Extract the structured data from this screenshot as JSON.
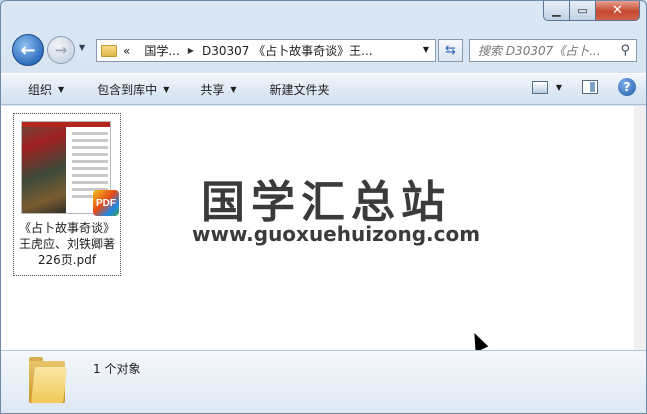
{
  "window": {
    "minimize_icon": "minimize-icon",
    "maximize_icon": "maximize-icon",
    "close_icon": "close-icon"
  },
  "nav": {
    "back_icon": "back-arrow-icon",
    "forward_icon": "forward-arrow-icon",
    "history_icon": "chevron-down-icon",
    "breadcrumb": {
      "overflow": "«",
      "items": [
        "国学...",
        "D30307 《占卜故事奇谈》王..."
      ]
    },
    "refresh_icon": "refresh-icon",
    "search_placeholder": "搜索 D30307《占卜...",
    "search_icon": "search-icon"
  },
  "commands": {
    "organize": "组织",
    "include_library": "包含到库中",
    "share": "共享",
    "new_folder": "新建文件夹"
  },
  "files": [
    {
      "name_lines": [
        "《占卜故事奇谈》",
        "王虎应、刘铁卿著",
        "226页.pdf"
      ],
      "type_badge": "PDF",
      "cover_header": "PDF"
    }
  ],
  "watermark": {
    "title": "国学汇总站",
    "url": "www.guoxuehuizong.com"
  },
  "details": {
    "status": "1 个对象"
  },
  "colors": {
    "accent": "#2f6fbf",
    "close": "#c74a33",
    "content_bg": "#ffffff"
  }
}
